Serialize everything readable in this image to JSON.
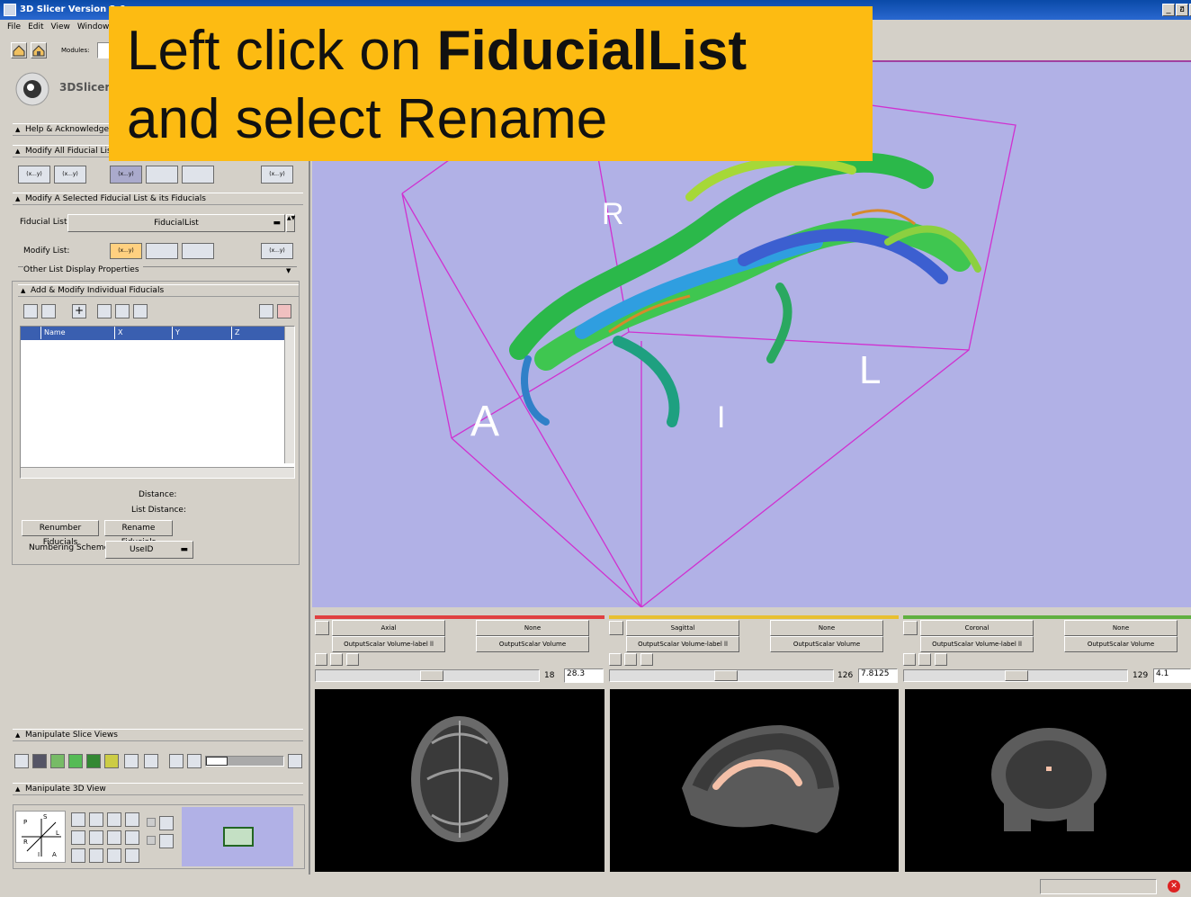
{
  "window": {
    "title": "3D Slicer Version 3.6.",
    "min": "_",
    "max": "ฮ",
    "close": "×"
  },
  "menu": [
    "File",
    "Edit",
    "View",
    "Window"
  ],
  "toolbar": {
    "modules_label": "Modules:",
    "logo_text": "3DSlicer"
  },
  "instruction": {
    "line1_prefix": "Left click on ",
    "line1_bold": "FiducialList",
    "line2": "and select Rename"
  },
  "panels": {
    "help": "Help & Acknowledgeme",
    "modify_all": "Modify All Fiducial Lists",
    "modify_selected": "Modify A Selected Fiducial List & its Fiducials",
    "fiducial_list_label": "Fiducial List:",
    "fiducial_list_value": "FiducialList",
    "modify_list_label": "Modify List:",
    "other_props": "Other List Display Properties",
    "add_modify": "Add & Modify Individual Fiducials",
    "columns": [
      "Name",
      "X",
      "Y",
      "Z"
    ],
    "distance_label": "Distance:",
    "list_distance_label": "List Distance:",
    "renumber_button": "Renumber Fiducials",
    "rename_button": "Rename Fiducials",
    "numbering_label": "Numbering Scheme:",
    "numbering_value": "UseID",
    "manipulate_slice": "Manipulate Slice Views",
    "manipulate_3d": "Manipulate 3D View",
    "button_glyph": "(x...y)"
  },
  "view3d": {
    "labels": [
      "R",
      "A",
      "I",
      "L"
    ],
    "background": "#b1b1e6",
    "box_color": "#d030d0"
  },
  "slices": [
    {
      "color": "#e04040",
      "orientation": "Axial",
      "fg": "None",
      "label_vol": "OutputScalar Volume-label ll",
      "bg_vol": "OutputScalar Volume",
      "slider_index": "18",
      "offset": "28.3"
    },
    {
      "color": "#e8c030",
      "orientation": "Sagittal",
      "fg": "None",
      "label_vol": "OutputScalar Volume-label ll",
      "bg_vol": "OutputScalar Volume",
      "slider_index": "126",
      "offset": "7.8125"
    },
    {
      "color": "#60b040",
      "orientation": "Coronal",
      "fg": "None",
      "label_vol": "OutputScalar Volume-label ll",
      "bg_vol": "OutputScalar Volume",
      "slider_index": "129",
      "offset": "4.1"
    }
  ],
  "orientation_cube": {
    "letters": [
      "P",
      "S",
      "L",
      "R",
      "I",
      "A"
    ]
  }
}
